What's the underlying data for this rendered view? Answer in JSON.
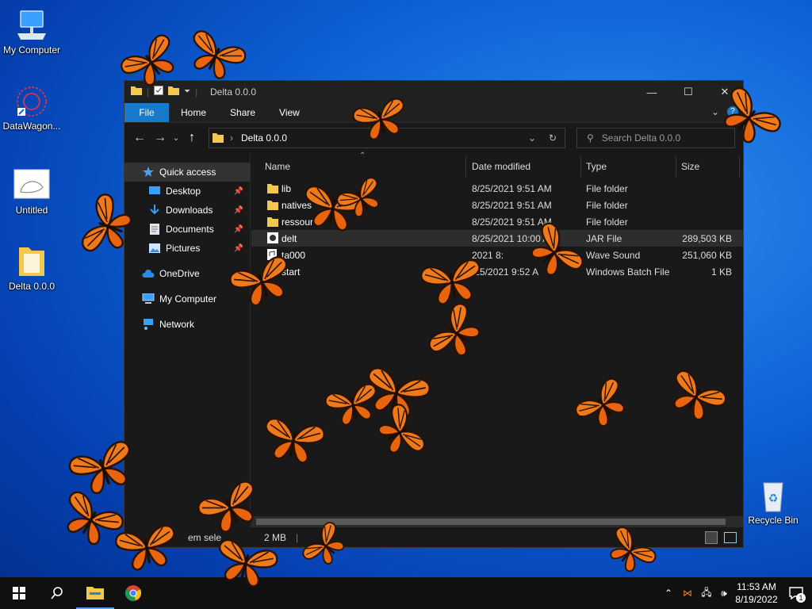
{
  "desktop": {
    "icons": [
      {
        "label": "My Computer",
        "icon": "computer-icon"
      },
      {
        "label": "DataWagon...",
        "icon": "datawagon-icon"
      },
      {
        "label": "Untitled",
        "icon": "image-file-icon"
      },
      {
        "label": "Delta 0.0.0",
        "icon": "folder-icon"
      },
      {
        "label": "Recycle Bin",
        "icon": "recycle-bin-icon"
      }
    ]
  },
  "window": {
    "title": "Delta 0.0.0",
    "ribbon_tabs": [
      "File",
      "Home",
      "Share",
      "View"
    ],
    "address_path": "Delta 0.0.0",
    "search_placeholder": "Search Delta 0.0.0",
    "sidebar": [
      {
        "label": "Quick access",
        "icon": "star-icon",
        "selected": true
      },
      {
        "label": "Desktop",
        "icon": "desktop-icon",
        "pinned": true
      },
      {
        "label": "Downloads",
        "icon": "download-icon",
        "pinned": true
      },
      {
        "label": "Documents",
        "icon": "document-icon",
        "pinned": true
      },
      {
        "label": "Pictures",
        "icon": "pictures-icon",
        "pinned": true
      },
      {
        "label": "OneDrive",
        "icon": "cloud-icon"
      },
      {
        "label": "My Computer",
        "icon": "computer-icon"
      },
      {
        "label": "Network",
        "icon": "network-icon"
      }
    ],
    "columns": [
      "Name",
      "Date modified",
      "Type",
      "Size"
    ],
    "files": [
      {
        "name": "lib",
        "date": "8/25/2021 9:51 AM",
        "type": "File folder",
        "size": "",
        "icon": "folder-icon"
      },
      {
        "name": "natives",
        "date": "8/25/2021 9:51 AM",
        "type": "File folder",
        "size": "",
        "icon": "folder-icon"
      },
      {
        "name": "ressour",
        "date": "8/25/2021 9:51 AM",
        "type": "File folder",
        "size": "",
        "icon": "folder-icon"
      },
      {
        "name": "delt",
        "date": "8/25/2021 10:00 AM",
        "type": "JAR File",
        "size": "289,503 KB",
        "icon": "jar-icon"
      },
      {
        "name": "ta000",
        "date": "2021 8:",
        "type": "Wave Sound",
        "size": "251,060 KB",
        "icon": "audio-icon"
      },
      {
        "name": "start",
        "date": "/25/2021 9:52 A",
        "type": "Windows Batch File",
        "size": "1 KB",
        "icon": "batch-icon"
      }
    ],
    "status_left": "em sele",
    "status_size": "2 MB"
  },
  "taskbar": {
    "time": "11:53 AM",
    "date": "8/19/2022",
    "notification_count": "1"
  },
  "colors": {
    "accent": "#1979ca",
    "folder": "#f2c94c",
    "butterfly": "#f07a1a"
  }
}
